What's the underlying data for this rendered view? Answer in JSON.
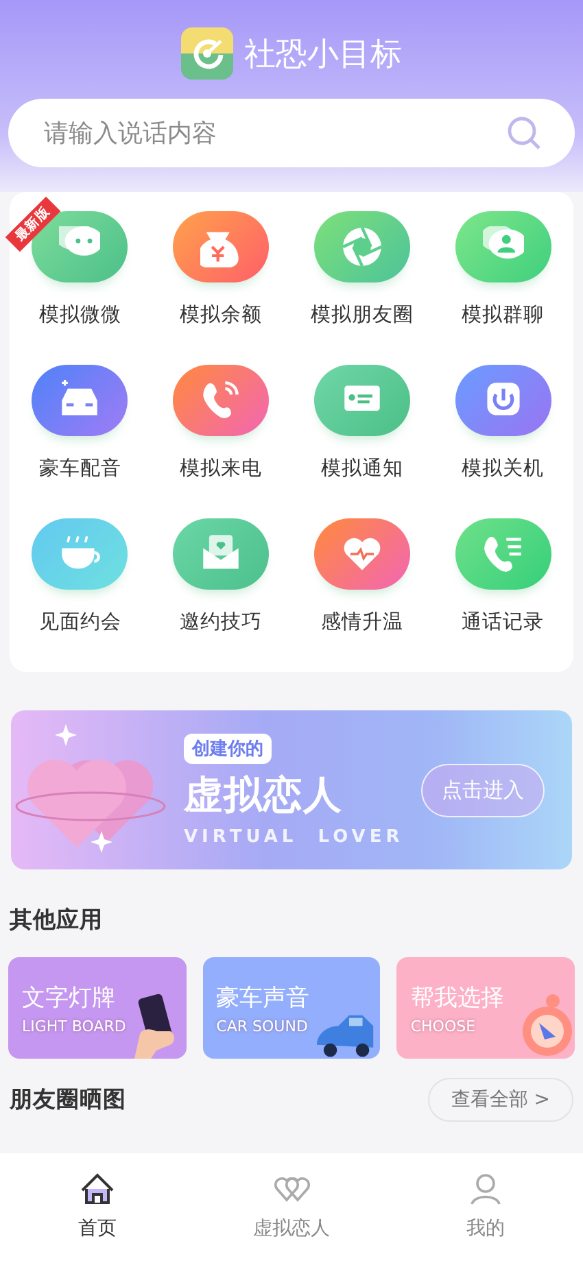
{
  "app_title": "社恐小目标",
  "search": {
    "placeholder": "请输入说话内容"
  },
  "features": [
    {
      "label": "模拟微微",
      "badge": "最新版"
    },
    {
      "label": "模拟余额"
    },
    {
      "label": "模拟朋友圈"
    },
    {
      "label": "模拟群聊"
    },
    {
      "label": "豪车配音"
    },
    {
      "label": "模拟来电"
    },
    {
      "label": "模拟通知"
    },
    {
      "label": "模拟关机"
    },
    {
      "label": "见面约会"
    },
    {
      "label": "邀约技巧"
    },
    {
      "label": "感情升温"
    },
    {
      "label": "通话记录"
    }
  ],
  "banner": {
    "tag": "创建你的",
    "title": "虚拟恋人",
    "subtitle": "VIRTUAL  LOVER",
    "button": "点击进入"
  },
  "other_apps": {
    "heading": "其他应用",
    "cards": [
      {
        "title": "文字灯牌",
        "subtitle": "LIGHT BOARD",
        "color": "#c597f0"
      },
      {
        "title": "豪车声音",
        "subtitle": "CAR SOUND",
        "color": "#93aefc"
      },
      {
        "title": "帮我选择",
        "subtitle": "CHOOSE",
        "color": "#fcb1c6"
      }
    ]
  },
  "moments": {
    "heading": "朋友圈晒图",
    "view_all": "查看全部 >"
  },
  "tabs": [
    {
      "label": "首页",
      "selected": true
    },
    {
      "label": "虚拟恋人",
      "selected": false
    },
    {
      "label": "我的",
      "selected": false
    }
  ]
}
